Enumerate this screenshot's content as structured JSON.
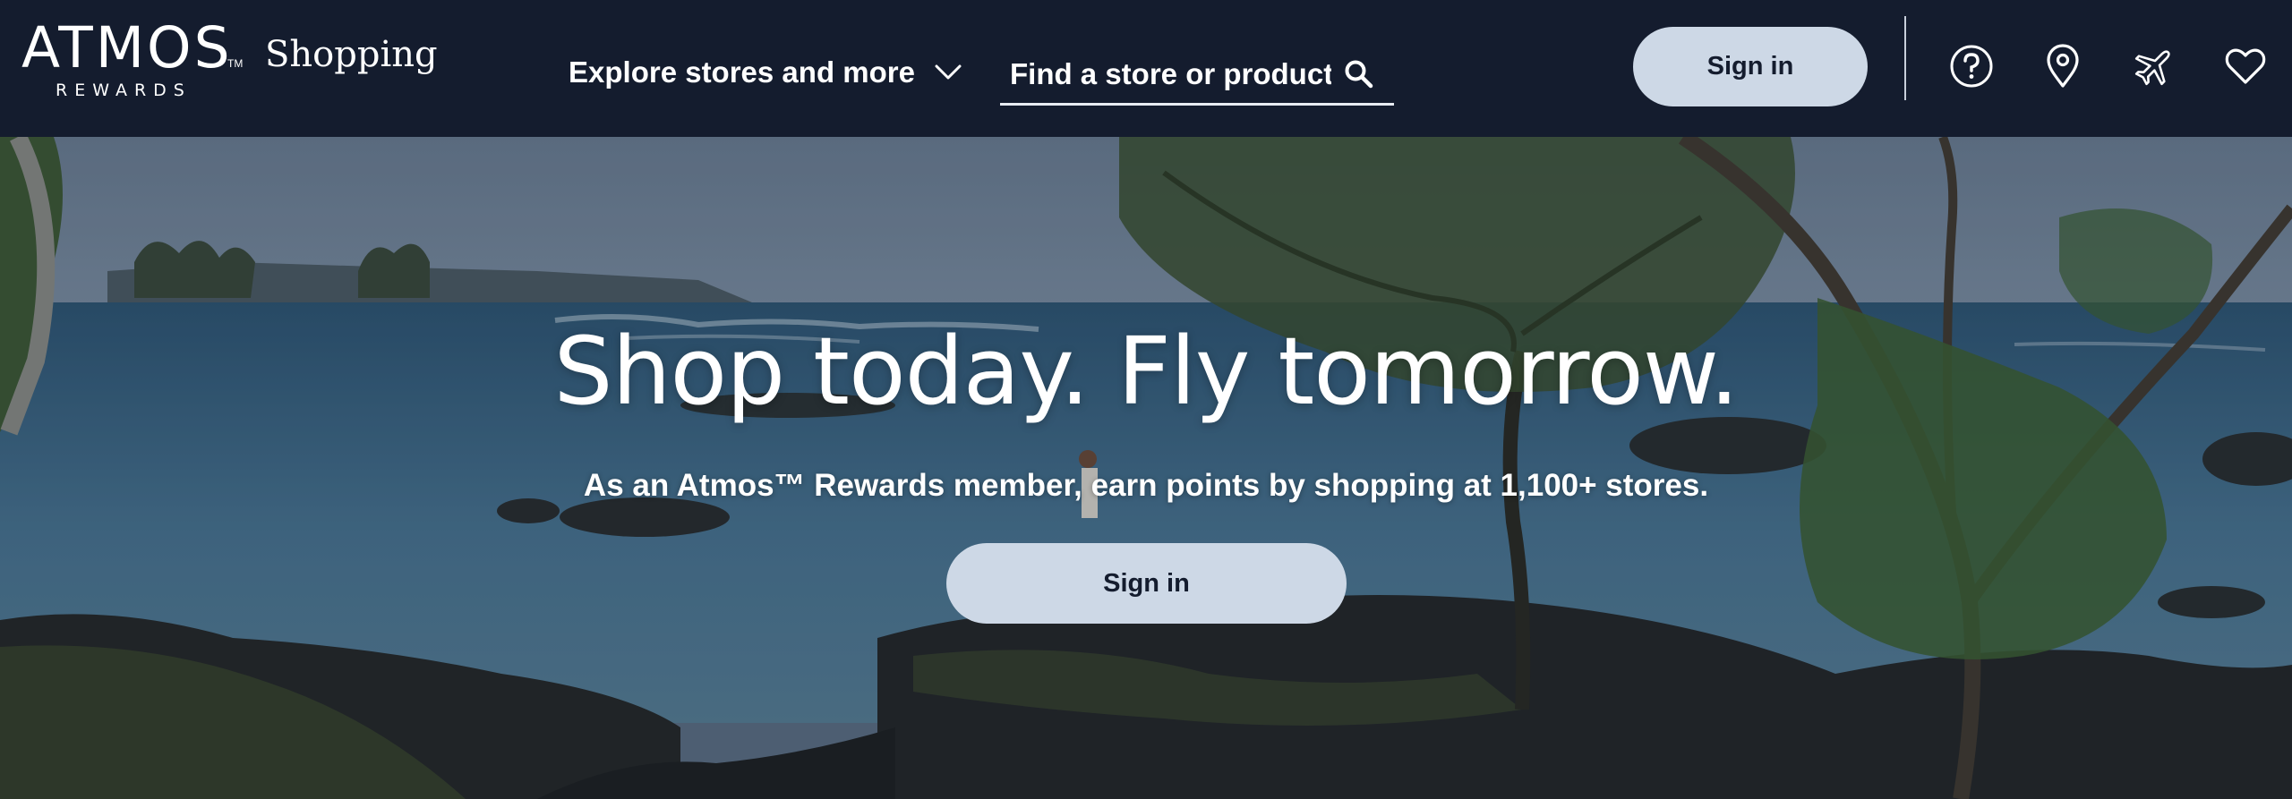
{
  "header": {
    "logo_text": "ATMOS",
    "logo_tm": "TM",
    "logo_subtext": "REWARDS",
    "section_label": "Shopping",
    "explore_label": "Explore stores and more",
    "search": {
      "placeholder": "Find a store or product",
      "value": ""
    },
    "signin_label": "Sign in",
    "icons": [
      "help-icon",
      "location-pin-icon",
      "airplane-icon",
      "heart-icon"
    ]
  },
  "hero": {
    "title": "Shop today. Fly tomorrow.",
    "subtitle": "As an Atmos™ Rewards member, earn points by shopping at 1,100+ stores.",
    "signin_label": "Sign in",
    "background": "coastal-lagoon-photo"
  },
  "colors": {
    "header_bg": "#141c2e",
    "button_bg": "#cdd8e6",
    "button_text": "#141c2e",
    "text": "#ffffff"
  }
}
